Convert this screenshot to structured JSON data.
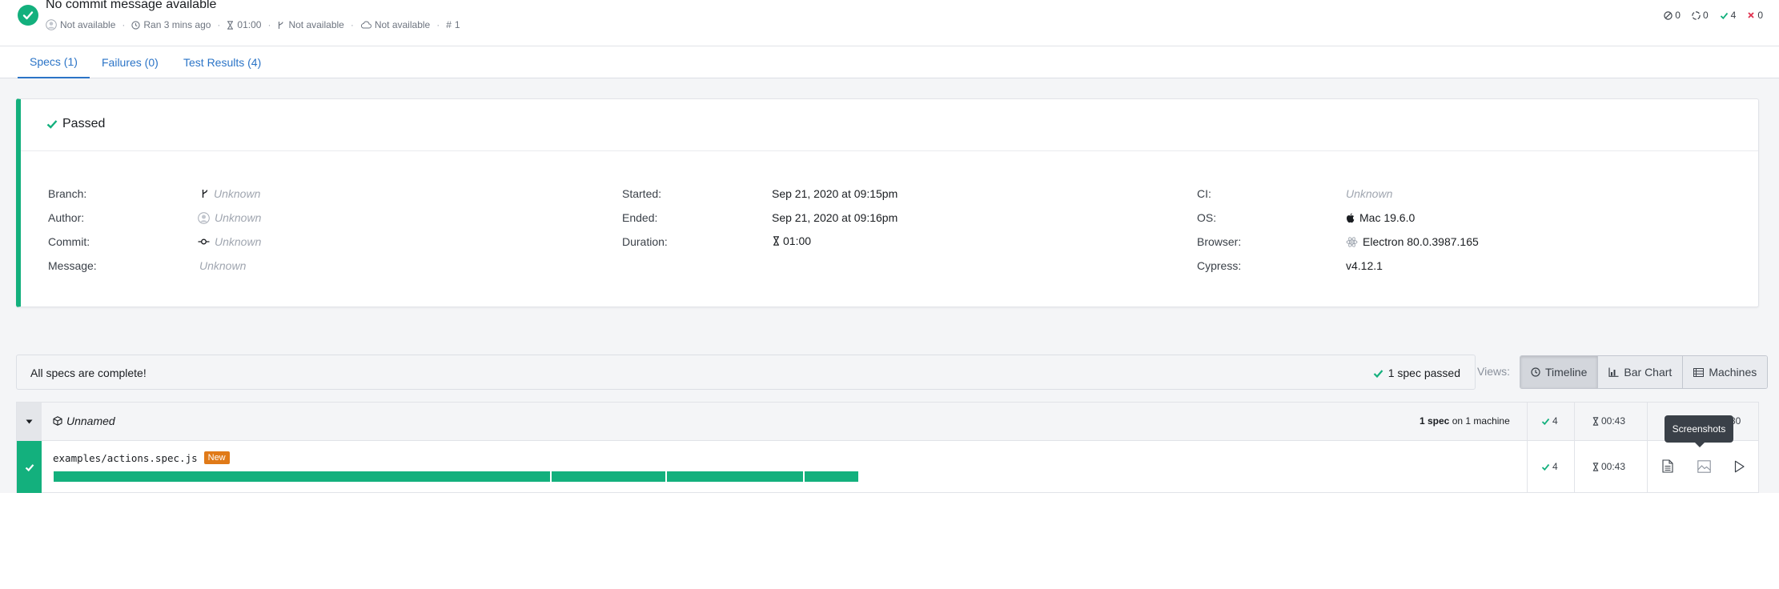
{
  "header": {
    "commit_message": "No commit message available",
    "meta": {
      "author": "Not available",
      "ran": "Ran 3 mins ago",
      "duration": "01:00",
      "branch": "Not available",
      "ci": "Not available",
      "run_number": "1"
    },
    "counts": {
      "skipped": "0",
      "pending": "0",
      "passed": "4",
      "failed": "0"
    }
  },
  "tabs": [
    {
      "label": "Specs (1)",
      "active": true
    },
    {
      "label": "Failures (0)",
      "active": false
    },
    {
      "label": "Test Results (4)",
      "active": false
    }
  ],
  "summary": {
    "status": "Passed",
    "left": [
      {
        "label": "Branch:",
        "value": "Unknown",
        "icon": "branch-icon"
      },
      {
        "label": "Author:",
        "value": "Unknown",
        "icon": "avatar-icon"
      },
      {
        "label": "Commit:",
        "value": "Unknown",
        "icon": "commit-icon"
      },
      {
        "label": "Message:",
        "value": "Unknown"
      }
    ],
    "middle": [
      {
        "label": "Started:",
        "value": "Sep 21, 2020 at 09:15pm"
      },
      {
        "label": "Ended:",
        "value": "Sep 21, 2020 at 09:16pm"
      },
      {
        "label": "Duration:",
        "value": "01:00",
        "icon": "hourglass-icon"
      }
    ],
    "right": [
      {
        "label": "CI:",
        "value": "Unknown"
      },
      {
        "label": "OS:",
        "value": "Mac 19.6.0",
        "icon": "apple-icon"
      },
      {
        "label": "Browser:",
        "value": "Electron 80.0.3987.165",
        "icon": "electron-icon"
      },
      {
        "label": "Cypress:",
        "value": "v4.12.1"
      }
    ]
  },
  "specs_bar": {
    "message": "All specs are complete!",
    "passed": "1 spec passed"
  },
  "views": {
    "label": "Views:",
    "options": [
      {
        "label": "Timeline",
        "active": true,
        "icon": "clock-icon"
      },
      {
        "label": "Bar Chart",
        "active": false,
        "icon": "bar-chart-icon"
      },
      {
        "label": "Machines",
        "active": false,
        "icon": "list-icon"
      }
    ]
  },
  "group": {
    "name": "Unnamed",
    "spec_count": "1 spec",
    "machine_text": "on 1 machine",
    "passed": "4",
    "duration": "00:43",
    "extra": "80"
  },
  "spec": {
    "name": "examples/actions.spec.js",
    "badge": "New",
    "passed": "4",
    "duration": "00:43",
    "timeline_segments": [
      620,
      142,
      170,
      67
    ]
  },
  "tooltip": "Screenshots",
  "colors": {
    "passed": "#13b07d",
    "link": "#2b74c7",
    "badge": "#e07a18",
    "failed": "#e0304e"
  }
}
